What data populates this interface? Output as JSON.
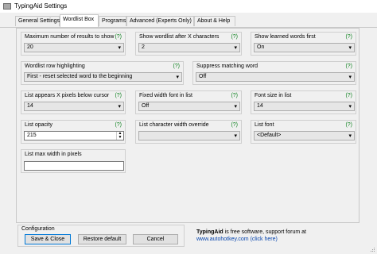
{
  "window": {
    "title": "TypingAid Settings"
  },
  "tabs": [
    {
      "label": "General Settings"
    },
    {
      "label": "Wordlist Box"
    },
    {
      "label": "Programs"
    },
    {
      "label": "Advanced (Experts Only)"
    },
    {
      "label": "About & Help"
    }
  ],
  "help_marker": "(?)",
  "settings": {
    "max_results": {
      "label": "Maximum number of results to show",
      "value": "20"
    },
    "show_after_chars": {
      "label": "Show wordlist after X characters",
      "value": "2"
    },
    "show_learned": {
      "label": "Show learned words first",
      "value": "On"
    },
    "row_highlighting": {
      "label": "Wordlist row highlighting",
      "value": "First - reset selected word to the beginning"
    },
    "suppress_matching": {
      "label": "Suppress matching word",
      "value": "Off"
    },
    "pixels_below_cursor": {
      "label": "List appears X pixels below cursor",
      "value": "14"
    },
    "fixed_width_font": {
      "label": "Fixed width font in list",
      "value": "Off"
    },
    "font_size": {
      "label": "Font size in list",
      "value": "14"
    },
    "list_opacity": {
      "label": "List opacity",
      "value": "215"
    },
    "char_width_override": {
      "label": "List character width override",
      "value": ""
    },
    "list_font": {
      "label": "List font",
      "value": "<Default>"
    },
    "max_width": {
      "label": "List max width in pixels",
      "value": ""
    }
  },
  "configuration": {
    "label": "Configuration",
    "save_close": "Save & Close",
    "restore_default": "Restore default",
    "cancel": "Cancel"
  },
  "footer": {
    "app_name": "TypingAid",
    "text": " is free software, support forum at",
    "link": "www.autohotkey.com",
    "link_suffix": " (click here)"
  }
}
